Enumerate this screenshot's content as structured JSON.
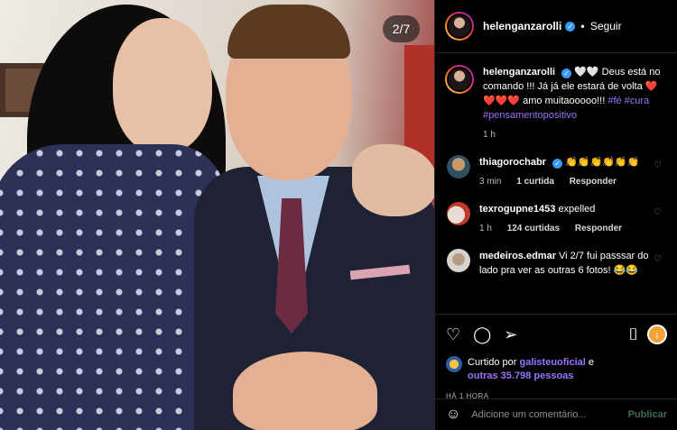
{
  "photo": {
    "counter": "2/7"
  },
  "header": {
    "username": "helenganzarolli",
    "follow_label": "Seguir",
    "separator": "•"
  },
  "caption": {
    "username": "helenganzarolli",
    "text": "🤍🤍 Deus está no comando !!! Já já ele estará de volta ❤️❤️❤️❤️ amo muitaooooo!!!",
    "tags": "#fé #cura #pensamentopositivo",
    "time": "1 h"
  },
  "comments": [
    {
      "username": "thiagorochabr",
      "text": "👏👏👏👏👏👏",
      "time": "3 min",
      "likes": "1 curtida",
      "reply": "Responder"
    },
    {
      "username": "texrogupne1453",
      "text": "expelled",
      "time": "1 h",
      "likes": "124 curtidas",
      "reply": "Responder"
    },
    {
      "username": "medeiros.edmar",
      "text": "Vi 2/7 fui passsar do lado pra ver as outras 6 fotos! 😂😂",
      "time": "",
      "likes": "",
      "reply": ""
    }
  ],
  "likes": {
    "prefix": "Curtido por",
    "user": "galisteuoficial",
    "conj": "e",
    "others": "outras 35.798 pessoas"
  },
  "timestamp": "HÁ 1 HORA",
  "add_comment": {
    "placeholder": "Adicione um comentário...",
    "post_label": "Publicar"
  },
  "colors": {
    "hashtag": "#9a74ff",
    "verified": "#3897f0"
  }
}
